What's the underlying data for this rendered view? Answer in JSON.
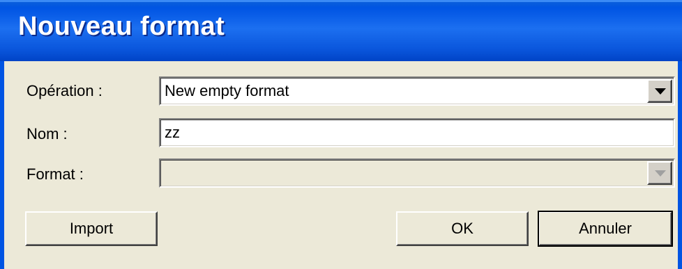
{
  "dialog": {
    "title": "Nouveau format",
    "fields": {
      "operation": {
        "label": "Opération :",
        "value": "New empty format"
      },
      "nom": {
        "label": "Nom :",
        "value": "zz"
      },
      "format": {
        "label": "Format :",
        "value": ""
      }
    },
    "buttons": {
      "import": "Import",
      "ok": "OK",
      "cancel": "Annuler"
    }
  },
  "colors": {
    "titlebar": "#0054e3",
    "dialog_bg": "#ece9d8",
    "title_text": "#ffffff"
  },
  "icons": {
    "dropdown": "chevron-down-icon"
  }
}
